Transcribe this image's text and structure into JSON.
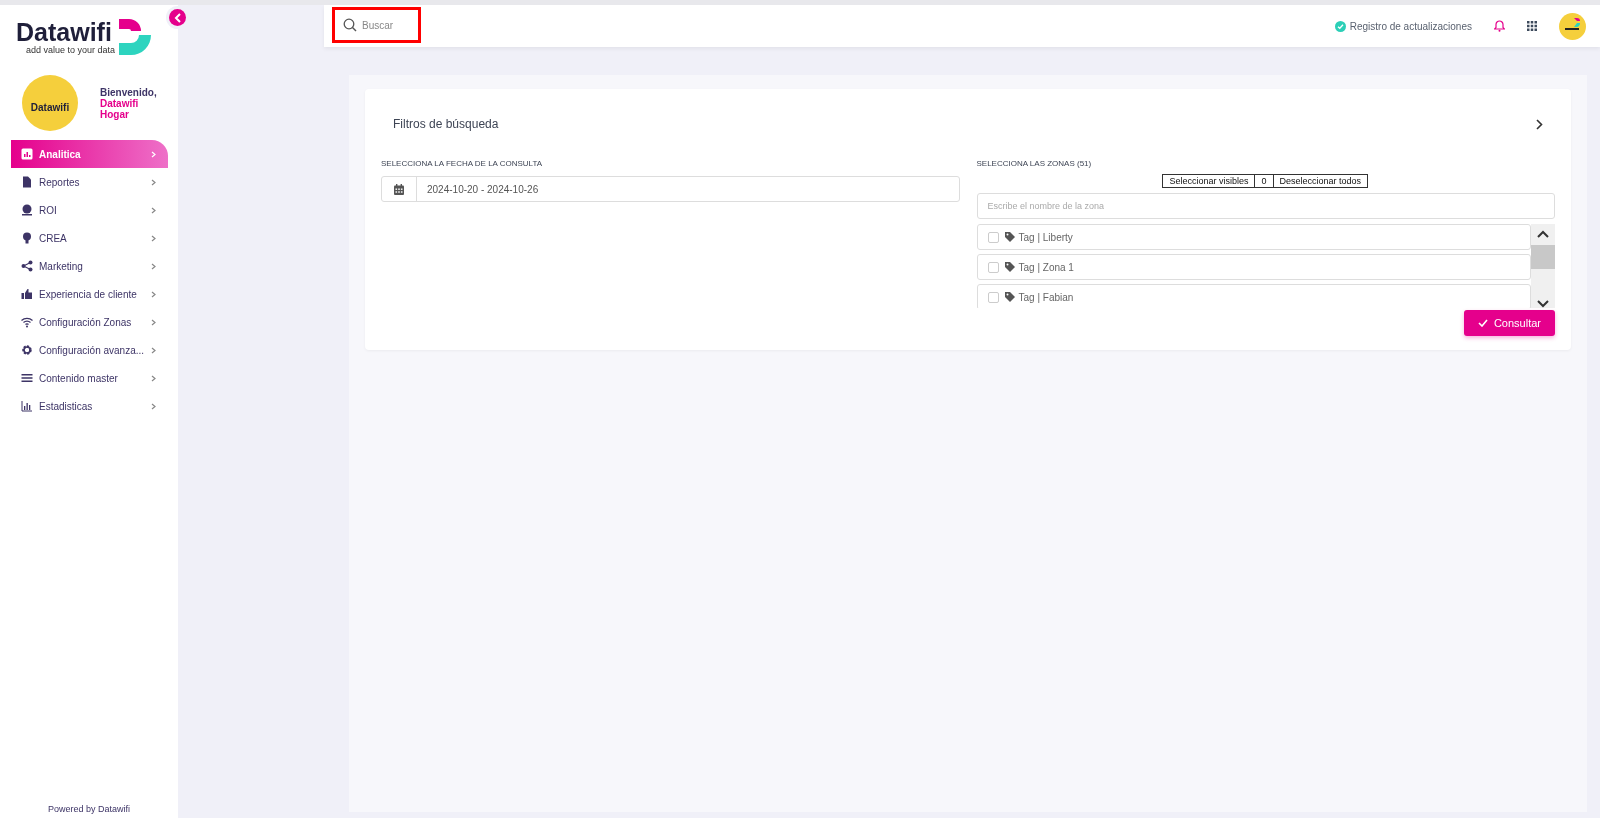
{
  "sidebar": {
    "logo": {
      "name": "Datawifi",
      "tagline": "add value to your data"
    },
    "profile": {
      "avatar_text": "Datawifi",
      "greeting": "Bienvenido,",
      "user": "Datawifi Hogar"
    },
    "items": [
      {
        "label": "Analitica",
        "selected": true
      },
      {
        "label": "Reportes",
        "selected": false
      },
      {
        "label": "ROI",
        "selected": false
      },
      {
        "label": "CREA",
        "selected": false
      },
      {
        "label": "Marketing",
        "selected": false
      },
      {
        "label": "Experiencia de cliente",
        "selected": false
      },
      {
        "label": "Configuración Zonas",
        "selected": false
      },
      {
        "label": "Configuración avanza...",
        "selected": false
      },
      {
        "label": "Contenido master",
        "selected": false
      },
      {
        "label": "Estadisticas",
        "selected": false
      }
    ],
    "footer": "Powered by Datawifi"
  },
  "topbar": {
    "search": {
      "placeholder": "Buscar"
    },
    "updates": "Registro de actualizaciones"
  },
  "filters": {
    "title": "Filtros de búsqueda",
    "date": {
      "label": "SELECCIONA LA FECHA DE LA CONSULTA",
      "value": "2024-10-20 - 2024-10-26"
    },
    "zones": {
      "label": "SELECCIONA LAS ZONAS (51)",
      "select_visible": "Seleccionar visibles",
      "count": "0",
      "deselect_all": "Deseleccionar todos",
      "placeholder": "Escribe el nombre de la zona",
      "items": [
        {
          "tag": "Tag | ",
          "name": "Liberty",
          "checked": false
        },
        {
          "tag": "Tag | ",
          "name": "Zona 1",
          "checked": false
        },
        {
          "tag": "Tag | ",
          "name": "Fabian",
          "checked": false
        }
      ]
    },
    "submit": "Consultar"
  }
}
